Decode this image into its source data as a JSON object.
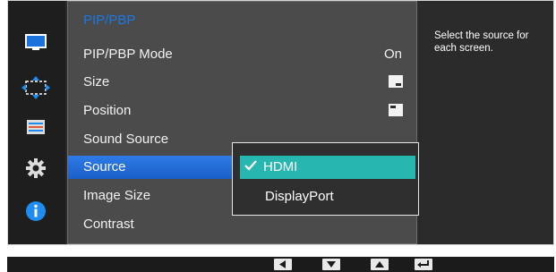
{
  "menu": {
    "title": "PIP/PBP",
    "items": [
      {
        "label": "PIP/PBP Mode",
        "value": "On"
      },
      {
        "label": "Size",
        "value_icon": "size-icon"
      },
      {
        "label": "Position",
        "value_icon": "position-icon"
      },
      {
        "label": "Sound Source"
      },
      {
        "label": "Source",
        "selected": true
      },
      {
        "label": "Image Size"
      },
      {
        "label": "Contrast"
      }
    ]
  },
  "dropdown": {
    "options": [
      {
        "label": "HDMI",
        "checked": true
      },
      {
        "label": "DisplayPort",
        "checked": false
      }
    ]
  },
  "help": {
    "text": "Select the source for each screen."
  },
  "sidebar": {
    "icons": [
      "picture-icon",
      "onscreen-display-icon",
      "position-adjust-icon",
      "settings-gear-icon",
      "info-icon"
    ]
  },
  "navbar": {
    "buttons": [
      "left-arrow-icon",
      "down-arrow-icon",
      "up-arrow-icon",
      "enter-icon"
    ]
  },
  "colors": {
    "title": "#1a78e3",
    "selection": "#1f66d6",
    "dropdown_active": "#27b7b0",
    "info": "#1e8cf0"
  }
}
